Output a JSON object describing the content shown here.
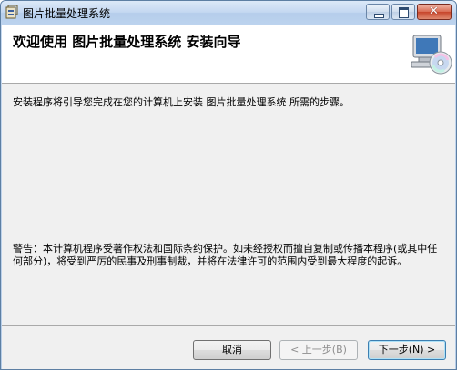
{
  "window": {
    "title": "图片批量处理系统",
    "close_glyph": "✕"
  },
  "header": {
    "heading": "欢迎使用 图片批量处理系统 安装向导"
  },
  "content": {
    "intro": "安装程序将引导您完成在您的计算机上安装 图片批量处理系统 所需的步骤。",
    "warning": "警告：本计算机程序受著作权法和国际条约保护。如未经授权而擅自复制或传播本程序(或其中任何部分)，将受到严厉的民事及刑事制裁，并将在法律许可的范围内受到最大程度的起诉。"
  },
  "buttons": {
    "cancel": "取消",
    "back": "< 上一步(B)",
    "next": "下一步(N) >"
  },
  "icons": {
    "app": "installer-app-icon",
    "header": "computer-cd-icon"
  }
}
